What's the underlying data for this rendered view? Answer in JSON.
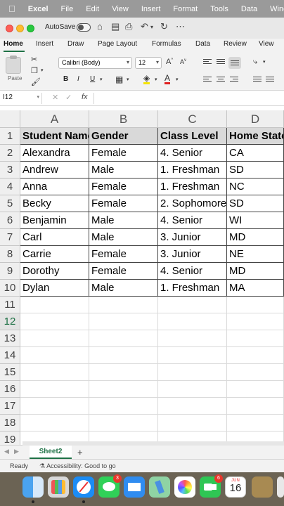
{
  "menubar": {
    "items": [
      "Excel",
      "File",
      "Edit",
      "View",
      "Insert",
      "Format",
      "Tools",
      "Data",
      "Window"
    ]
  },
  "titlebar": {
    "autosave_label": "AutoSave"
  },
  "ribbon": {
    "tabs": [
      "Home",
      "Insert",
      "Draw",
      "Page Layout",
      "Formulas",
      "Data",
      "Review",
      "View"
    ],
    "active_tab": "Home",
    "paste_label": "Paste",
    "font_name": "Calibri (Body)",
    "font_size": "12",
    "grow_font": "A",
    "shrink_font": "A",
    "bold": "B",
    "italic": "I",
    "underline": "U"
  },
  "formula_bar": {
    "name_box": "I12",
    "fx": "fx",
    "value": ""
  },
  "sheet": {
    "columns": [
      "A",
      "B",
      "C",
      "D"
    ],
    "row_numbers": [
      "1",
      "2",
      "3",
      "4",
      "5",
      "6",
      "7",
      "8",
      "9",
      "10",
      "11",
      "12",
      "13",
      "14",
      "15",
      "16",
      "17",
      "18",
      "19"
    ],
    "active_row": "12",
    "header": [
      "Student Name",
      "Gender",
      "Class Level",
      "Home State"
    ],
    "rows": [
      [
        "Alexandra",
        "Female",
        "4. Senior",
        "CA"
      ],
      [
        "Andrew",
        "Male",
        "1. Freshman",
        "SD"
      ],
      [
        "Anna",
        "Female",
        "1. Freshman",
        "NC"
      ],
      [
        "Becky",
        "Female",
        "2. Sophomore",
        "SD"
      ],
      [
        "Benjamin",
        "Male",
        "4. Senior",
        "WI"
      ],
      [
        "Carl",
        "Male",
        "3. Junior",
        "MD"
      ],
      [
        "Carrie",
        "Female",
        "3. Junior",
        "NE"
      ],
      [
        "Dorothy",
        "Female",
        "4. Senior",
        "MD"
      ],
      [
        "Dylan",
        "Male",
        "1. Freshman",
        "MA"
      ]
    ]
  },
  "sheet_tabs": {
    "tabs": [
      "Sheet2"
    ],
    "add_label": "+"
  },
  "status_bar": {
    "ready": "Ready",
    "accessibility": "Accessibility: Good to go"
  },
  "dock": {
    "apps": [
      "finder-icon",
      "launchpad-icon",
      "safari-icon",
      "messages-icon",
      "mail-icon",
      "maps-icon",
      "photos-icon",
      "facetime-icon",
      "calendar-icon",
      "notes-icon"
    ],
    "messages_badge": "3",
    "facetime_badge": "6",
    "calendar_month": "JUN",
    "calendar_day": "16"
  },
  "colors": {
    "excel_green": "#1e7145",
    "menubar": "#9a9a9a",
    "header_fill": "#d9d9d9",
    "dock": "#6b6354"
  }
}
